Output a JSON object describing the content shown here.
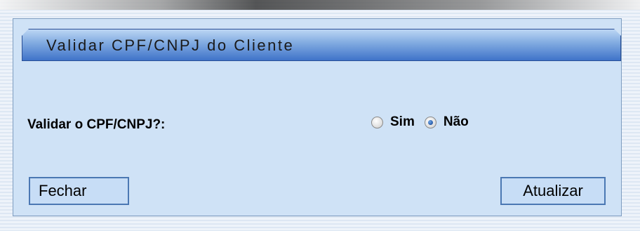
{
  "panel": {
    "title": "Validar CPF/CNPJ do Cliente"
  },
  "form": {
    "validate_label": "Validar o CPF/CNPJ?:",
    "options": [
      {
        "label": "Sim",
        "checked": false
      },
      {
        "label": "Não",
        "checked": true
      }
    ]
  },
  "buttons": {
    "close_label": "Fechar",
    "update_label": "Atualizar"
  },
  "colors": {
    "panel_bg": "#cfe2f6",
    "header_gradient_bottom": "#3f73c9",
    "button_border": "#4b78b3"
  }
}
